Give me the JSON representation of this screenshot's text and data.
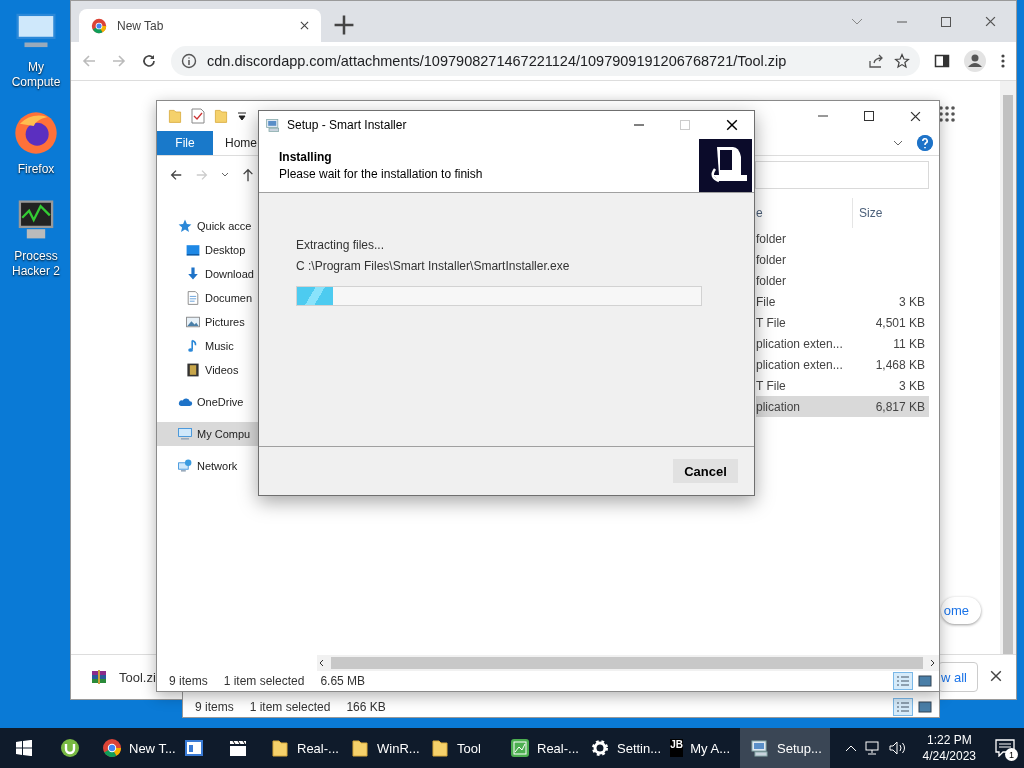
{
  "desktop_icons": [
    {
      "kind": "computer",
      "label": "My Compute"
    },
    {
      "kind": "firefox",
      "label": "Firefox"
    },
    {
      "kind": "monitor",
      "label": "Process Hacker 2"
    }
  ],
  "browser": {
    "tab": {
      "title": "New Tab"
    },
    "url": "cdn.discordapp.com/attachments/1097908271467221124/1097909191206768721/Tool.zip",
    "chip": "ome",
    "download": {
      "file": "Tool.zi",
      "show_all": "w all"
    }
  },
  "explorer": {
    "ribbon_tabs": [
      {
        "label": "File",
        "selected": true
      },
      {
        "label": "Home",
        "selected": false
      }
    ],
    "nav": [
      {
        "label": "Quick acce",
        "kind": "star",
        "selected": false,
        "children": [
          {
            "label": "Desktop",
            "kind": "desktop",
            "selected": false
          },
          {
            "label": "Download",
            "kind": "download",
            "selected": false
          },
          {
            "label": "Documen",
            "kind": "document",
            "selected": false
          },
          {
            "label": "Pictures",
            "kind": "picture",
            "selected": false
          },
          {
            "label": "Music",
            "kind": "music",
            "selected": false
          },
          {
            "label": "Videos",
            "kind": "video",
            "selected": false
          }
        ]
      },
      {
        "label": "OneDrive",
        "kind": "cloud",
        "selected": false
      },
      {
        "label": "My Compu",
        "kind": "computer",
        "selected": true
      },
      {
        "label": "Network",
        "kind": "network",
        "selected": false
      }
    ],
    "columns": [
      "e",
      "Size"
    ],
    "rows": [
      {
        "type": "folder",
        "selected": false
      },
      {
        "type": "folder",
        "selected": false
      },
      {
        "type": "folder",
        "selected": false
      },
      {
        "type": "File",
        "size": "3 KB",
        "selected": false
      },
      {
        "type": "T File",
        "size": "4,501 KB",
        "selected": false
      },
      {
        "type": "plication exten...",
        "size": "11 KB",
        "selected": false
      },
      {
        "type": "plication exten...",
        "size": "1,468 KB",
        "selected": false
      },
      {
        "type": "T File",
        "size": "3 KB",
        "selected": false
      },
      {
        "type": "plication",
        "size": "6,817 KB",
        "selected": true
      }
    ],
    "status": {
      "items": "9 items",
      "selection": "1 item selected",
      "size": "6.65 MB"
    }
  },
  "back_explorer": {
    "status": {
      "items": "9 items",
      "selection": "1 item selected",
      "size": "166 KB"
    }
  },
  "setup": {
    "title": "Setup - Smart Installer",
    "heading": "Installing",
    "subheading": "Please wait for the installation to finish",
    "status": "Extracting files...",
    "path": "C :\\Program Files\\Smart Installer\\SmartInstaller.exe",
    "level": 0.09,
    "cancel": "Cancel"
  },
  "taskbar": {
    "items": [
      {
        "kind": "torrent",
        "selected": false
      },
      {
        "kind": "chrome",
        "label": "New T...",
        "selected": false
      },
      {
        "kind": "window",
        "selected": false
      },
      {
        "kind": "clapper",
        "selected": false
      },
      {
        "kind": "folder",
        "label": "Real-...",
        "selected": false
      },
      {
        "kind": "folder",
        "label": "WinR...",
        "selected": false
      },
      {
        "kind": "folder",
        "label": "Tool",
        "selected": false
      },
      {
        "kind": "sheet",
        "label": "Real-...",
        "selected": false
      },
      {
        "kind": "gear",
        "label": "Settin...",
        "selected": false
      },
      {
        "kind": "jb",
        "badge": "JB",
        "label": "My A...",
        "selected": false
      },
      {
        "kind": "setup",
        "label": "Setup...",
        "selected": true
      }
    ],
    "time": "1:22 PM",
    "date": "4/24/2023",
    "notifications": "1"
  }
}
